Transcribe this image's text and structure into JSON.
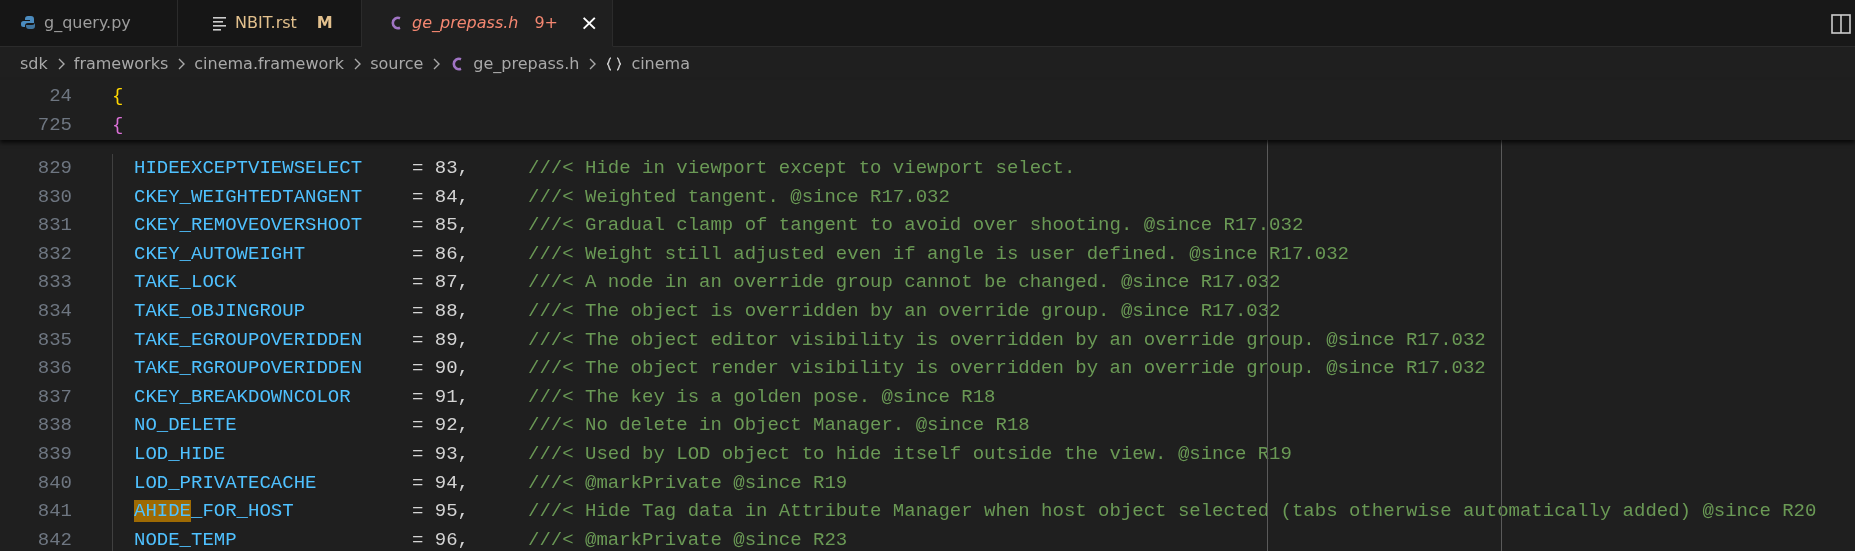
{
  "tabs": [
    {
      "label": "g_query.py",
      "kind": "python",
      "selected": false,
      "preview": false,
      "has_errors": false
    },
    {
      "label": "NBIT.rst",
      "kind": "text",
      "selected": false,
      "preview": false,
      "has_errors": false,
      "status": "M"
    },
    {
      "label": "ge_prepass.h",
      "kind": "c",
      "selected": true,
      "preview": true,
      "has_errors": true,
      "problems": "9+",
      "close": "×"
    }
  ],
  "breadcrumb": [
    {
      "label": "sdk",
      "kind": "folder"
    },
    {
      "label": "frameworks",
      "kind": "folder"
    },
    {
      "label": "cinema.framework",
      "kind": "folder"
    },
    {
      "label": "source",
      "kind": "folder"
    },
    {
      "label": "ge_prepass.h",
      "kind": "c"
    },
    {
      "label": "cinema",
      "kind": "namespace"
    }
  ],
  "sticky_lines": [
    {
      "number": "24",
      "text": "{",
      "kind": "bracket-level-1"
    },
    {
      "number": "725",
      "text": "{",
      "kind": "bracket-level-2"
    }
  ],
  "lines": [
    {
      "number": "829",
      "name": "HIDEEXCEPTVIEWSELECT",
      "value": "= 83,",
      "comment": "///< Hide in viewport except to viewport select."
    },
    {
      "number": "830",
      "name": "CKEY_WEIGHTEDTANGENT",
      "value": "= 84,",
      "comment": "///< Weighted tangent. @since R17.032"
    },
    {
      "number": "831",
      "name": "CKEY_REMOVEOVERSHOOT",
      "value": "= 85,",
      "comment": "///< Gradual clamp of tangent to avoid over shooting. @since R17.032"
    },
    {
      "number": "832",
      "name": "CKEY_AUTOWEIGHT",
      "value": "= 86,",
      "comment": "///< Weight still adjusted even if angle is user defined. @since R17.032"
    },
    {
      "number": "833",
      "name": "TAKE_LOCK",
      "value": "= 87,",
      "comment": "///< A node in an override group cannot be changed. @since R17.032"
    },
    {
      "number": "834",
      "name": "TAKE_OBJINGROUP",
      "value": "= 88,",
      "comment": "///< The object is overridden by an override group. @since R17.032"
    },
    {
      "number": "835",
      "name": "TAKE_EGROUPOVERIDDEN",
      "value": "= 89,",
      "comment": "///< The object editor visibility is overridden by an override group. @since R17.032"
    },
    {
      "number": "836",
      "name": "TAKE_RGROUPOVERIDDEN",
      "value": "= 90,",
      "comment": "///< The object render visibility is overridden by an override group. @since R17.032"
    },
    {
      "number": "837",
      "name": "CKEY_BREAKDOWNCOLOR",
      "value": "= 91,",
      "comment": "///< The key is a golden pose. @since R18"
    },
    {
      "number": "838",
      "name": "NO_DELETE",
      "value": "= 92,",
      "comment": "///< No delete in Object Manager. @since R18"
    },
    {
      "number": "839",
      "name": "LOD_HIDE",
      "value": "= 93,",
      "comment": "///< Used by LOD object to hide itself outside the view. @since R19"
    },
    {
      "number": "840",
      "name": "LOD_PRIVATECACHE",
      "value": "= 94,",
      "comment": "///< @markPrivate @since R19"
    },
    {
      "number": "841",
      "name_segments": [
        {
          "text": "AHIDE",
          "highlighted": true
        },
        {
          "text": "_FOR_HOST",
          "highlighted": false
        }
      ],
      "value": "= 95,",
      "comment": "///< Hide Tag data in Attribute Manager when host object selected (tabs otherwise automatically added) @since R20"
    },
    {
      "number": "842",
      "name": "NODE_TEMP",
      "value": "= 96,",
      "comment": "///< @markPrivate @since R23"
    }
  ]
}
